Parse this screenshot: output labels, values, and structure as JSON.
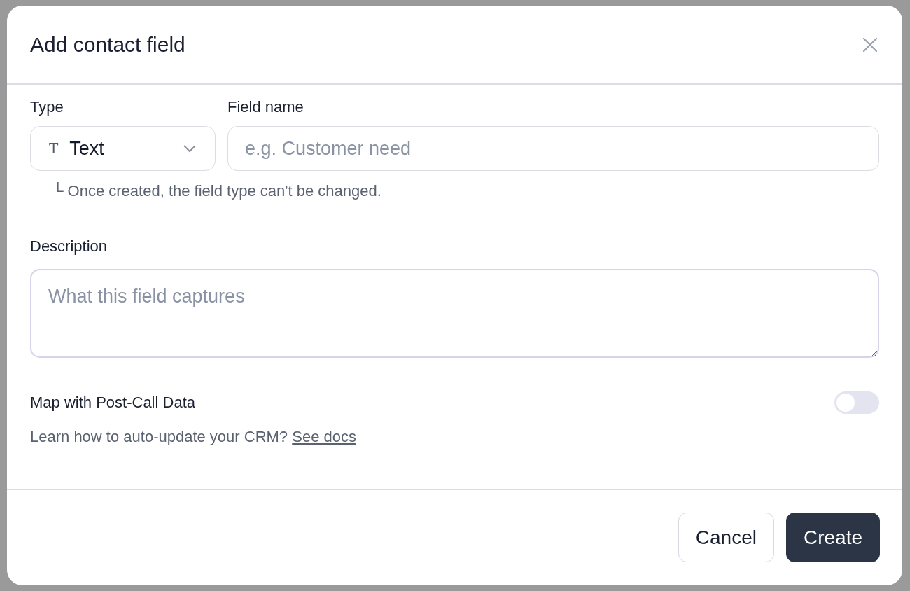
{
  "dialog": {
    "title": "Add contact field"
  },
  "type_field": {
    "label": "Type",
    "value": "Text",
    "icon_text": "T",
    "hint_mark": "└",
    "hint": "Once created, the field type can't be changed."
  },
  "name_field": {
    "label": "Field name",
    "placeholder": "e.g. Customer need"
  },
  "description_field": {
    "label": "Description",
    "placeholder": "What this field captures"
  },
  "mapping": {
    "label": "Map with Post-Call Data",
    "on": false,
    "help": "Learn how to auto-update your CRM?",
    "link": "See docs"
  },
  "buttons": [
    {
      "label": "Cancel",
      "kind": "secondary"
    },
    {
      "label": "Create",
      "kind": "primary"
    }
  ]
}
